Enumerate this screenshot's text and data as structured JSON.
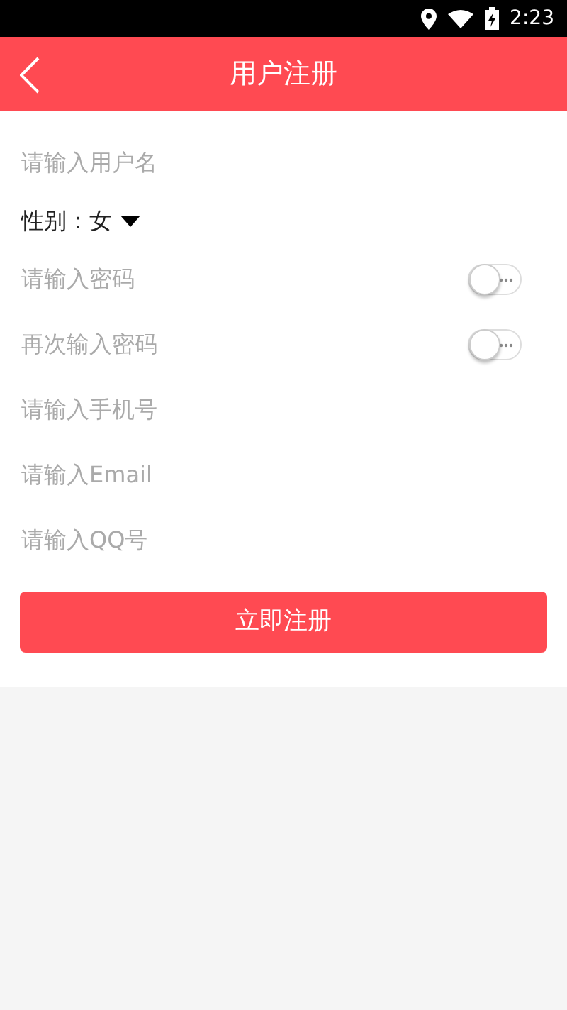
{
  "status_bar": {
    "time": "2:23"
  },
  "header": {
    "title": "用户注册"
  },
  "form": {
    "fields": [
      {
        "kind": "text",
        "placeholder": "请输入用户名"
      },
      {
        "kind": "select",
        "label": "性别：",
        "value": "女"
      },
      {
        "kind": "password",
        "placeholder": "请输入密码",
        "show_password": false
      },
      {
        "kind": "password",
        "placeholder": "再次输入密码",
        "show_password": false
      },
      {
        "kind": "text",
        "placeholder": "请输入手机号"
      },
      {
        "kind": "text",
        "placeholder": "请输入Email"
      },
      {
        "kind": "text",
        "placeholder": "请输入QQ号"
      }
    ],
    "submit": "立即注册"
  }
}
